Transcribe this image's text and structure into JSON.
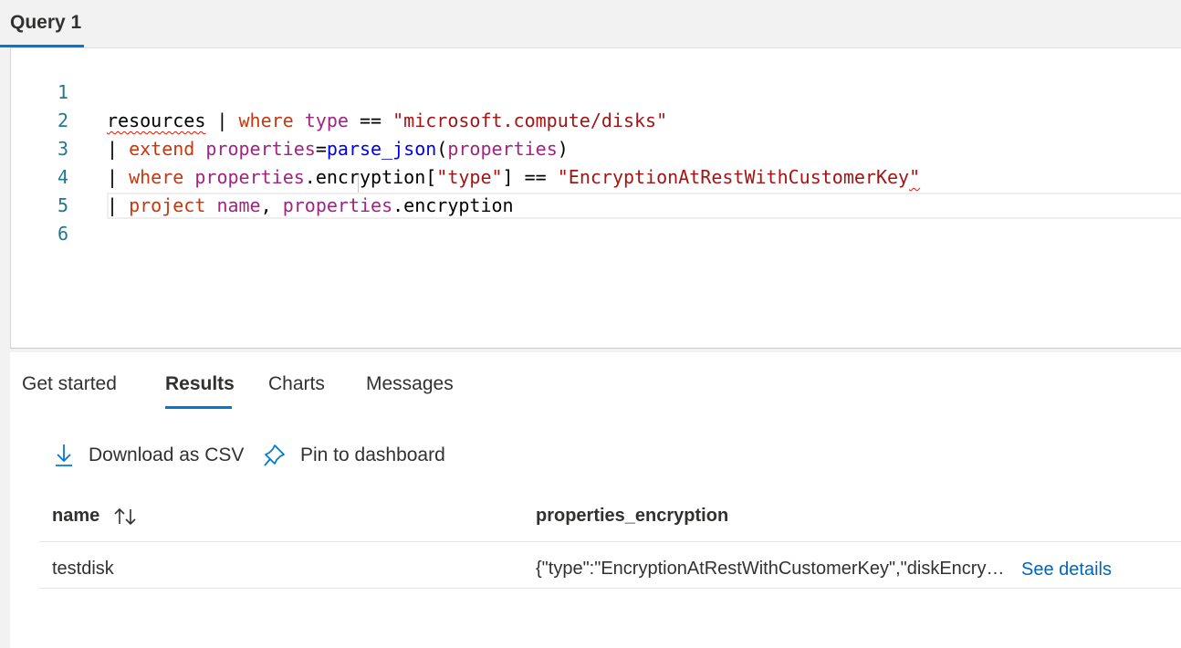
{
  "header": {
    "tab_title": "Query 1"
  },
  "editor": {
    "line_numbers": [
      "1",
      "2",
      "3",
      "4",
      "5",
      "6"
    ],
    "line1": {
      "resource": "resources",
      "pipe": " | ",
      "kw": "where",
      "sp": " ",
      "prop": "type",
      "op": " == ",
      "str": "\"microsoft.compute/disks\""
    },
    "line2": {
      "pipe": "| ",
      "kw": "extend",
      "sp": " ",
      "prop": "properties",
      "eq": "=",
      "fn": "parse_json",
      "open": "(",
      "arg": "properties",
      "close": ")"
    },
    "line3": {
      "pipe": "| ",
      "kw": "where",
      "sp": " ",
      "prop": "properties",
      "rest": ".encryption[",
      "key": "\"type\"",
      "close": "] == ",
      "str_main": "\"EncryptionAtRestWithCustomerKey",
      "str_end": "\""
    },
    "line4": {
      "pipe": "| ",
      "kw": "project",
      "sp": " ",
      "col1": "name",
      "comma": ", ",
      "prop": "properties",
      "rest": ".encryption"
    }
  },
  "results": {
    "tabs": [
      "Get started",
      "Results",
      "Charts",
      "Messages"
    ],
    "active_tab": "Results",
    "actions": {
      "download": "Download as CSV",
      "pin": "Pin to dashboard"
    },
    "columns": [
      "name",
      "properties_encryption"
    ],
    "rows": [
      {
        "name": "testdisk",
        "properties_encryption": "{\"type\":\"EncryptionAtRestWithCustomerKey\",\"diskEncryptionSetId\"",
        "details_link": "See details"
      }
    ]
  },
  "colors": {
    "accent": "#0078d4",
    "link": "#0067b8",
    "keyword": "#c8370f",
    "property": "#a1247f",
    "string": "#a31515",
    "function": "#0000e6",
    "line_number": "#237893"
  }
}
